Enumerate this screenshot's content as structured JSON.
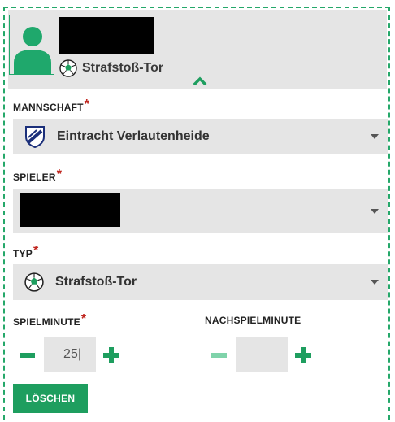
{
  "header": {
    "event_type": "Strafstoß-Tor",
    "icons": {
      "avatar": "user-silhouette-icon",
      "ball": "soccer-ball-icon",
      "collapse": "chevron-up-icon"
    }
  },
  "form": {
    "team": {
      "label": "MANNSCHAFT",
      "required_mark": "*",
      "value": "Eintracht Verlautenheide",
      "icon": "club-crest-icon"
    },
    "player": {
      "label": "SPIELER",
      "required_mark": "*",
      "value": ""
    },
    "type": {
      "label": "TYP",
      "required_mark": "*",
      "value": "Strafstoß-Tor",
      "icon": "soccer-ball-icon"
    },
    "minute": {
      "label": "SPIELMINUTE",
      "required_mark": "*",
      "value": "25|"
    },
    "extra_minute": {
      "label": "NACHSPIELMINUTE",
      "value": ""
    },
    "delete_label": "LÖSCHEN"
  },
  "colors": {
    "accent": "#1e9e5f",
    "required": "#c0261f",
    "field_bg": "#e5e5e5"
  }
}
